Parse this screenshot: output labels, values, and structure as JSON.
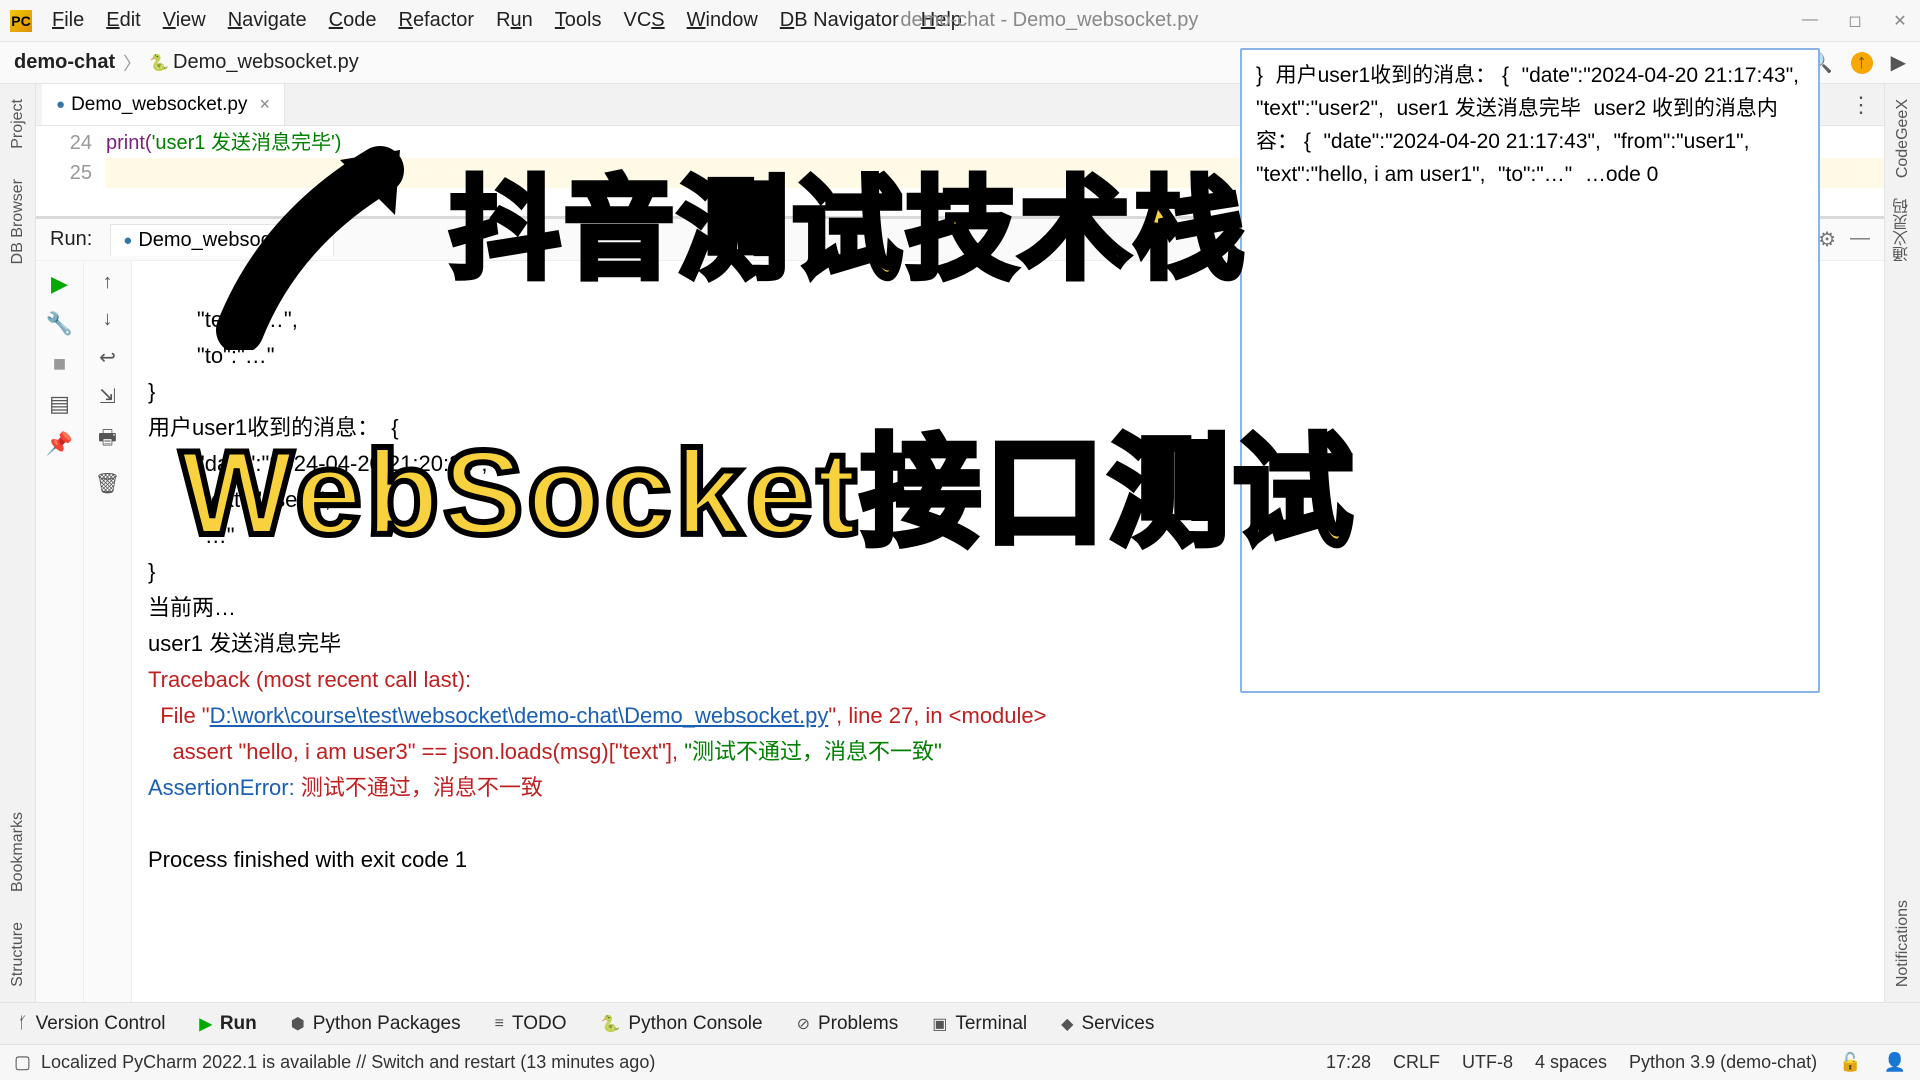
{
  "menubar": {
    "items": [
      "File",
      "Edit",
      "View",
      "Navigate",
      "Code",
      "Refactor",
      "Run",
      "Tools",
      "VCS",
      "Window",
      "DB Navigator",
      "Help"
    ],
    "title": "demo-chat - Demo_websocket.py"
  },
  "breadcrumb": {
    "project": "demo-chat",
    "file": "Demo_websocket.py"
  },
  "editor": {
    "tab_label": "Demo_websocket.py",
    "lines": {
      "24": "24",
      "25": "25"
    },
    "code24_a": "print(",
    "code24_b": "'user1 ",
    "code24_c": "发送消息完毕')"
  },
  "run": {
    "label": "Run:",
    "tab": "Demo_websocket"
  },
  "console": {
    "l1": "        \"text\":\"…\",",
    "l2": "        \"to\":\"…\"",
    "l3": "}",
    "l4a": "用户",
    "l4b": "user1",
    "l4c": "收到的消息：  {",
    "l5": "        \"date\":\"2024-04-20 21:20:33\",",
    "l6": "        \"text\":\"user2\",",
    "l7": "        \"…\"",
    "l8": "}",
    "l9": "当前两…",
    "l10": "user1 发送消息完毕",
    "l11": "Traceback (most recent call last):",
    "l12a": "  File \"",
    "l12link": "D:\\work\\course\\test\\websocket\\demo-chat\\Demo_websocket.py",
    "l12b": "\", line 27, in <module>",
    "l13a": "    assert ",
    "l13b": "\"hello, i am user3\" == json.loads(msg)[\"text\"], ",
    "l13c": "\"测试不通过，消息不一致\"",
    "l14a": "AssertionError: ",
    "l14b": "测试不通过，消息不一致",
    "l15": "",
    "l16": "Process finished with exit code 1"
  },
  "popup": {
    "l0": "}",
    "l1": "用户user1收到的消息：  {",
    "l2": "    \"date\":\"2024-04-20 21:17:43\",",
    "l3": "    \"text\":\"user2\",",
    "l7": "user1 发送消息完毕",
    "l8": "user2 收到的消息内容：  {",
    "l9": "    \"date\":\"2024-04-20 21:17:43\",",
    "l10": "    \"from\":\"user1\",",
    "l11": "    \"text\":\"hello, i am user1\",",
    "l12": "    \"to\":\"…\"",
    "lend": "                               …ode 0"
  },
  "bottom": {
    "vc": "Version Control",
    "run": "Run",
    "pkg": "Python Packages",
    "todo": "TODO",
    "console": "Python Console",
    "problems": "Problems",
    "terminal": "Terminal",
    "services": "Services"
  },
  "status": {
    "msg": "Localized PyCharm 2022.1 is available // Switch and restart (13 minutes ago)",
    "pos": "17:28",
    "sep": "CRLF",
    "enc": "UTF-8",
    "indent": "4 spaces",
    "interp": "Python 3.9 (demo-chat)"
  },
  "overlay": {
    "line1": "抖音测试技术栈",
    "line2": "WebSocket接口测试"
  },
  "sidebars": {
    "project": "Project",
    "db": "DB Browser",
    "bookmarks": "Bookmarks",
    "structure": "Structure",
    "codegeex": "CodeGeeX",
    "tongyi": "通义灵码",
    "notif": "Notifications"
  }
}
